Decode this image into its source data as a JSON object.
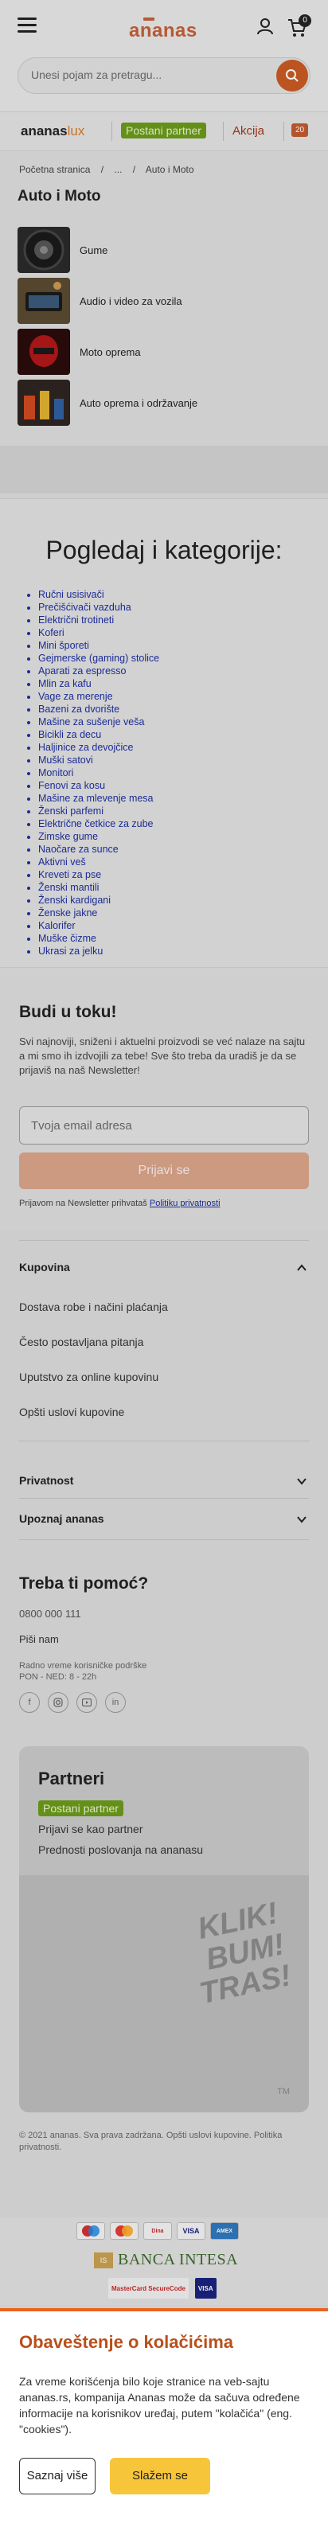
{
  "header": {
    "logo": "ananas",
    "cart_count": "0",
    "search_placeholder": "Unesi pojam za pretragu..."
  },
  "promo": {
    "lux_prefix": "ananas",
    "lux_suffix": "lux",
    "partner_label": "Postani partner",
    "akcija_label": "Akcija",
    "hot_label": "20"
  },
  "breadcrumb": {
    "home": "Početna stranica",
    "sep1": "/",
    "dots": "...",
    "sep2": "/",
    "current": "Auto i Moto"
  },
  "page_title": "Auto i Moto",
  "categories": [
    {
      "label": "Gume",
      "icon": "tire-image"
    },
    {
      "label": "Audio i video za vozila",
      "icon": "car-audio-image"
    },
    {
      "label": "Moto oprema",
      "icon": "moto-gear-image"
    },
    {
      "label": "Auto oprema i održavanje",
      "icon": "car-care-image"
    }
  ],
  "browse": {
    "title": "Pogledaj i kategorije:",
    "items": [
      "Ručni usisivači",
      "Prečišćivači vazduha",
      "Električni trotineti",
      "Koferi",
      "Mini šporeti",
      "Gejmerske (gaming) stolice",
      "Aparati za espresso",
      "Mlin za kafu",
      "Vage za merenje",
      "Bazeni za dvorište",
      "Mašine za sušenje veša",
      "Bicikli za decu",
      "Haljinice za devojčice",
      "Muški satovi",
      "Monitori",
      "Fenovi za kosu",
      "Mašine za mlevenje mesa",
      "Ženski parfemi",
      "Električne četkice za zube",
      "Zimske gume",
      "Naočare za sunce",
      "Aktivni veš",
      "Kreveti za pse",
      "Ženski mantili",
      "Ženski kardigani",
      "Ženske jakne",
      "Kalorifer",
      "Muške čizme",
      "Ukrasi za jelku"
    ]
  },
  "newsletter": {
    "title": "Budi u toku!",
    "text": "Svi najnoviji, sniženi i aktuelni proizvodi se već nalaze na sajtu a mi smo ih izdvojili za tebe! Sve što treba da uradiš je da se prijaviš na naš Newsletter!",
    "email_placeholder": "Tvoja email adresa",
    "submit_label": "Prijavi se",
    "privacy_prefix": "Prijavom na Newsletter prihvataš",
    "privacy_link": "Politiku privatnosti"
  },
  "footer": {
    "kupovina_title": "Kupovina",
    "kupovina_links": [
      "Dostava robe i načini plaćanja",
      "Često postavljana pitanja",
      "Uputstvo za online kupovinu",
      "Opšti uslovi kupovine"
    ],
    "privatnost_title": "Privatnost",
    "upoznaj_title": "Upoznaj ananas",
    "help_title": "Treba ti pomoć?",
    "phone": "0800 000 111",
    "write": "Piši nam",
    "hours_label": "Radno vreme korisničke podrške",
    "hours": "PON - NED: 8 - 22h",
    "socials": [
      "facebook-icon",
      "instagram-icon",
      "youtube-icon",
      "linkedin-icon"
    ],
    "partners": {
      "title": "Partneri",
      "badge": "Postani partner",
      "link1": "Prijavi se kao partner",
      "link2": "Prednosti poslovanja na ananasu",
      "slogan": [
        "KLIK!",
        "BUM!",
        "TRAS!"
      ],
      "tm": "TM"
    },
    "copyright": "© 2021 ananas. Sva prava zadržana. Opšti uslovi kupovine. Politika privatnosti."
  },
  "payments": {
    "cards": [
      "maestro",
      "mastercard",
      "dinacard",
      "visa",
      "amex"
    ],
    "bank": "BANCA INTESA",
    "secure": [
      "MasterCard SecureCode",
      "VISA"
    ]
  },
  "cookie": {
    "title": "Obaveštenje o kolačićima",
    "text": "Za vreme korišćenja bilo koje stranice na veb-sajtu ananas.rs, kompanija Ananas može da sačuva određene informacije na korisnikov uređaj, putem \"kolačića\" (eng. \"cookies\").",
    "more_label": "Saznaj više",
    "accept_label": "Slažem se"
  }
}
